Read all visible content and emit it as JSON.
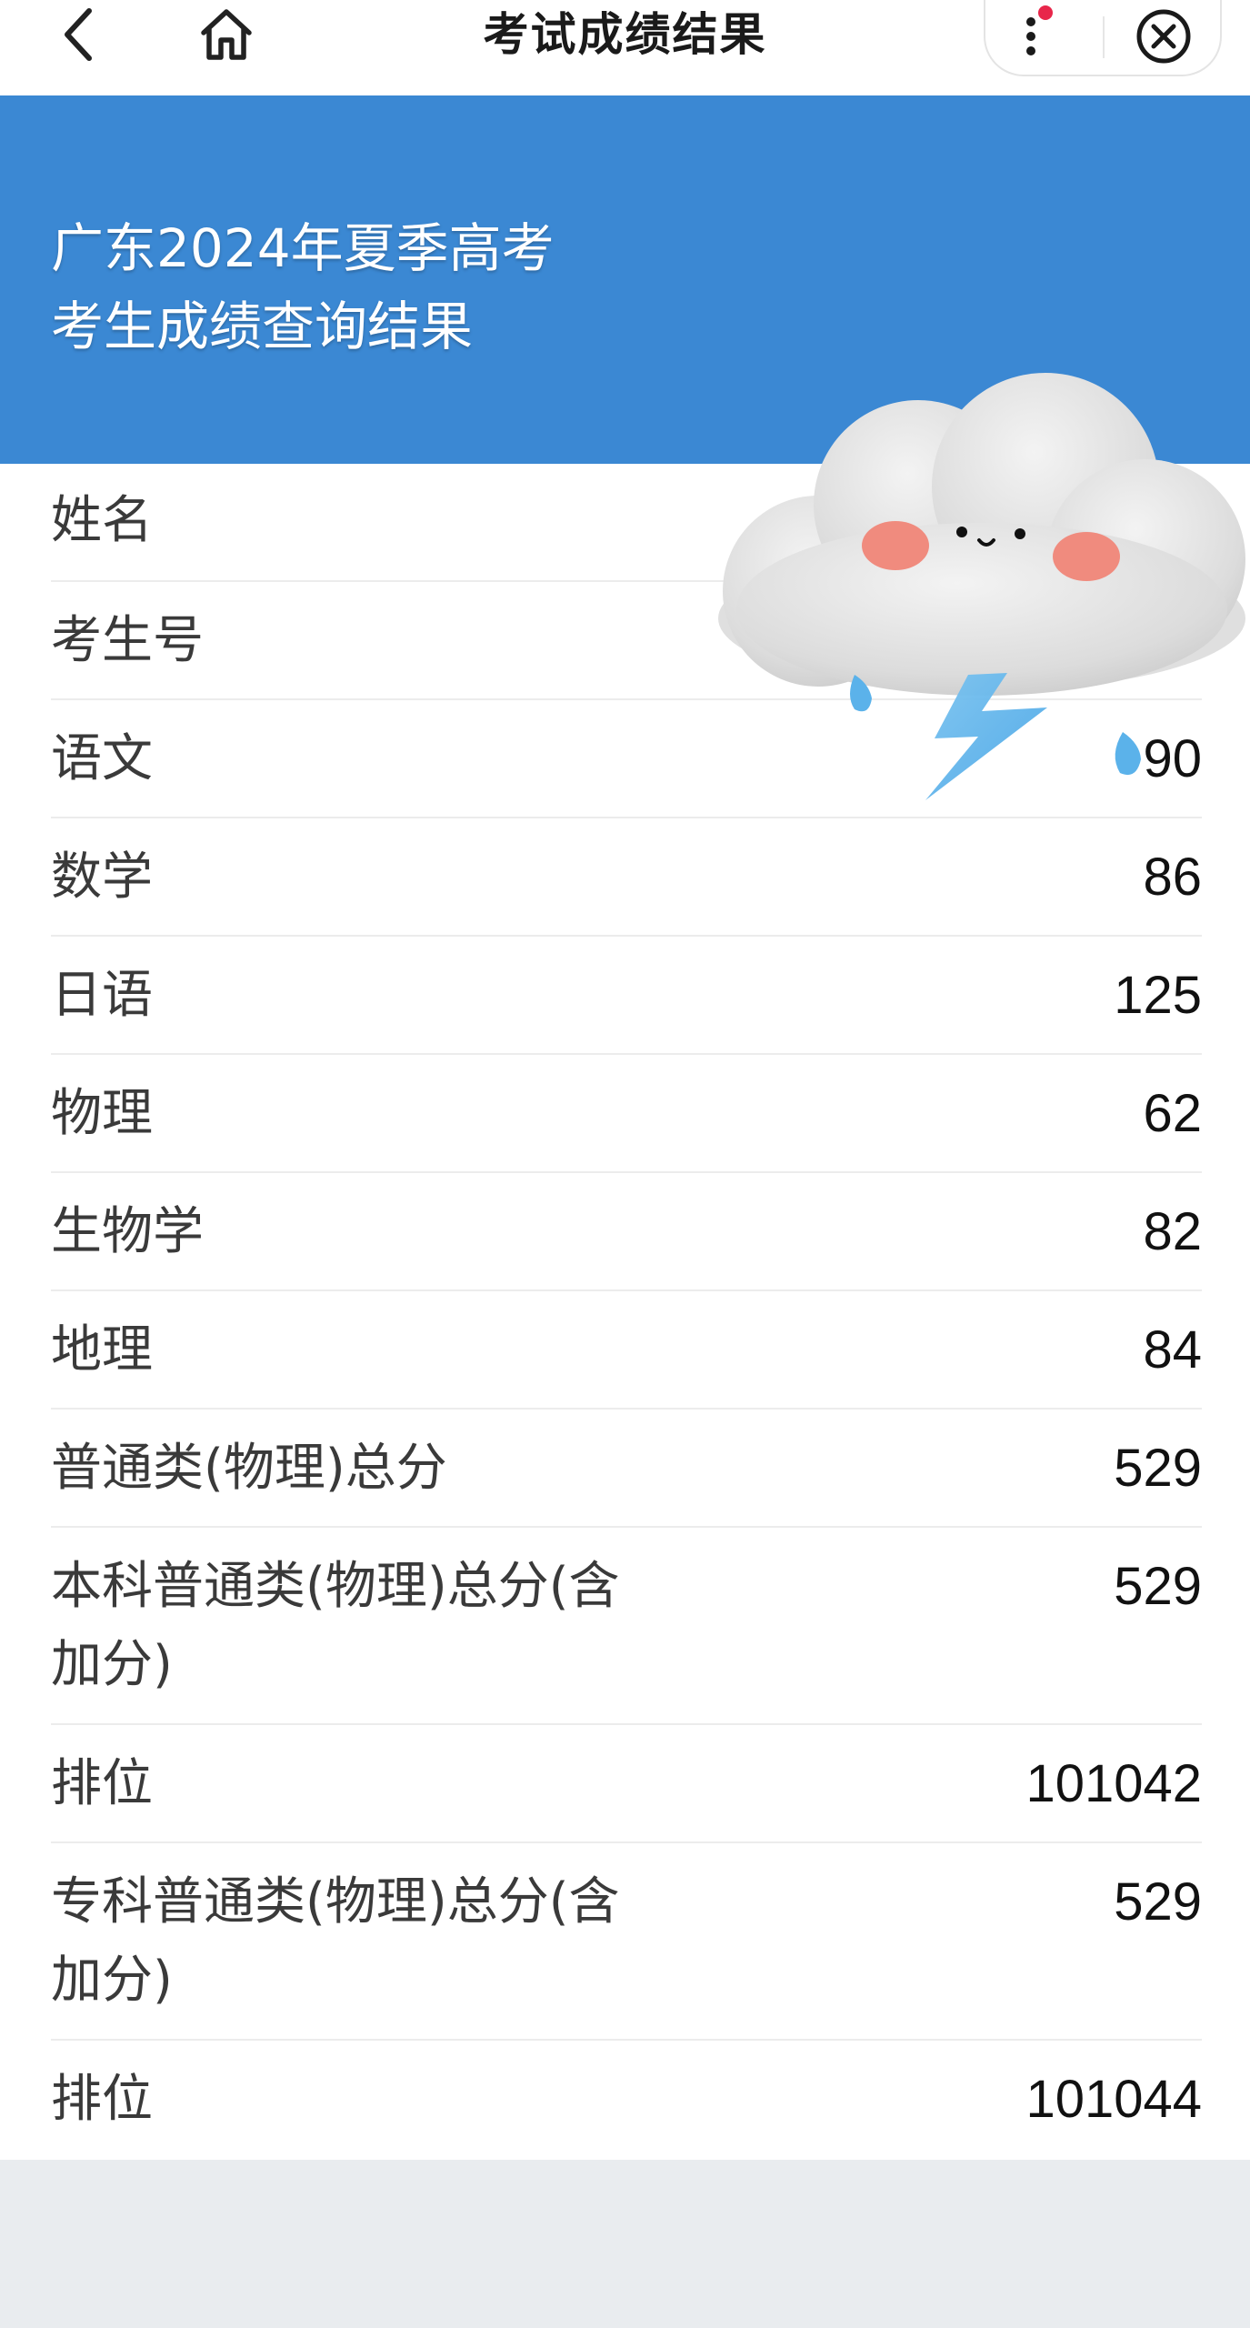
{
  "navbar": {
    "title": "考试成绩结果",
    "back_icon": "chevron-left-icon",
    "home_icon": "home-icon",
    "more_icon": "more-vertical-icon",
    "close_icon": "close-circle-icon",
    "notification_dot_color": "#e8264a"
  },
  "header": {
    "line1": "广东2024年夏季高考",
    "line2": "考生成绩查询结果",
    "background_color": "#3b88d3"
  },
  "results": [
    {
      "label": "姓名",
      "value": ""
    },
    {
      "label": "考生号",
      "value": ""
    },
    {
      "label": "语文",
      "value": "90"
    },
    {
      "label": "数学",
      "value": "86"
    },
    {
      "label": "日语",
      "value": "125"
    },
    {
      "label": "物理",
      "value": "62"
    },
    {
      "label": "生物学",
      "value": "82"
    },
    {
      "label": "地理",
      "value": "84"
    },
    {
      "label": "普通类(物理)总分",
      "value": "529"
    },
    {
      "label": "本科普通类(物理)总分(含加分)",
      "value": "529"
    },
    {
      "label": "排位",
      "value": "101042"
    },
    {
      "label": "专科普通类(物理)总分(含加分)",
      "value": "529"
    },
    {
      "label": "排位",
      "value": "101044"
    }
  ],
  "sticker": "cloud-sticker-icon"
}
